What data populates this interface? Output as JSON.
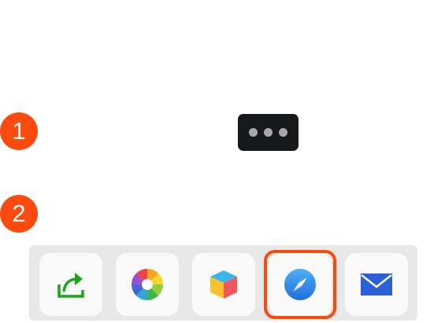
{
  "steps": [
    {
      "label": "1"
    },
    {
      "label": "2"
    }
  ],
  "more_button": {
    "icon": "more-dots-icon"
  },
  "share_tray": {
    "items": [
      {
        "icon": "share-arrow-icon",
        "color": "#1aa51a"
      },
      {
        "icon": "photos-aperture-icon"
      },
      {
        "icon": "3d-cube-icon"
      },
      {
        "icon": "safari-compass-icon",
        "color": "#2a7ae2",
        "highlighted": true
      },
      {
        "icon": "mail-envelope-icon",
        "color": "#2d5fd8"
      }
    ]
  },
  "colors": {
    "accent": "#fc4a0e",
    "more_button_bg": "#18191b",
    "tray_bg": "#e8e8e8"
  }
}
